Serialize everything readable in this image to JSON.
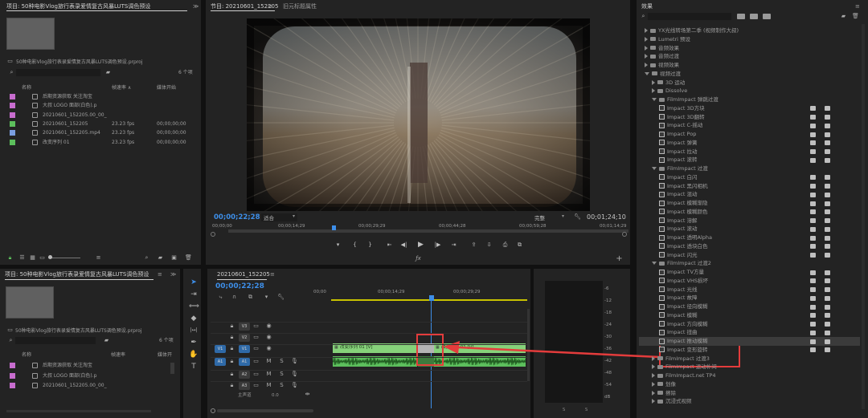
{
  "project_top": {
    "tab": "项目: 50种电影Vlog旅行表录爱情复古风暴LUTS调色预设",
    "tab2_arrow": "≫",
    "project_file": "50种电影Vlog旅行表录爱情复古风暴LUTS调色预设.prproj",
    "item_count": "6 个项",
    "col_name": "名称",
    "col_fps": "帧速率 ∧",
    "col_start": "媒体开始",
    "items": [
      {
        "color": "#c86dcf",
        "name": "后期资源获取 关注淘宝",
        "fps": "",
        "start": ""
      },
      {
        "color": "#c86dcf",
        "name": "大叔 LOGO 面部(白色).p",
        "fps": "",
        "start": ""
      },
      {
        "color": "#c86dcf",
        "name": "20210601_152205.00_00_55",
        "fps": "",
        "start": ""
      },
      {
        "color": "#5cbf5c",
        "name": "20210601_152205",
        "fps": "23.23 fps",
        "start": "00;00;00;00"
      },
      {
        "color": "#7a9ee0",
        "name": "20210601_152205.mp4",
        "fps": "23.23 fps",
        "start": "00;00;00;00"
      },
      {
        "color": "#5cbf5c",
        "name": "改变序列 01",
        "fps": "23.23 fps",
        "start": "00;00;00;00"
      }
    ]
  },
  "program": {
    "tab": "节目: 20210601_152205",
    "tab_menu": "≡",
    "tab2": "旧元标题属性",
    "timecode": "00;00;22;28",
    "fit": "适合",
    "quality": "完整",
    "duration": "00;01;24;10",
    "ruler": [
      "00;00;00",
      "00;00;14;29",
      "00;00;29;29",
      "00;00;44;28",
      "00;00;59;28",
      "00;01;14;29"
    ]
  },
  "effects": {
    "tab": "效果",
    "tab_menu": "≡",
    "tree": [
      {
        "level": 0,
        "kind": "folder",
        "open": false,
        "label": "YX光线转场第二季 (视频制作大叔)"
      },
      {
        "level": 0,
        "kind": "folder",
        "open": false,
        "label": "Lumetri 预设"
      },
      {
        "level": 0,
        "kind": "folder",
        "open": false,
        "label": "音频效果"
      },
      {
        "level": 0,
        "kind": "folder",
        "open": false,
        "label": "音频过渡"
      },
      {
        "level": 0,
        "kind": "folder",
        "open": false,
        "label": "视频效果"
      },
      {
        "level": 0,
        "kind": "folder",
        "open": true,
        "label": "视频过渡"
      },
      {
        "level": 1,
        "kind": "folder",
        "open": false,
        "label": "3D 运动"
      },
      {
        "level": 1,
        "kind": "folder",
        "open": false,
        "label": "Dissolve"
      },
      {
        "level": 1,
        "kind": "folder",
        "open": true,
        "label": "FilmImpact 弹跳过渡"
      },
      {
        "level": 2,
        "kind": "fx",
        "label": "Impact 3D方块",
        "badges": true
      },
      {
        "level": 2,
        "kind": "fx",
        "label": "Impact 3D翻转",
        "badges": true
      },
      {
        "level": 2,
        "kind": "fx",
        "label": "Impact C-摇动",
        "badges": true
      },
      {
        "level": 2,
        "kind": "fx",
        "label": "Impact Pop",
        "badges": true
      },
      {
        "level": 2,
        "kind": "fx",
        "label": "Impact 弹簧",
        "badges": true
      },
      {
        "level": 2,
        "kind": "fx",
        "label": "Impact 拉动",
        "badges": true
      },
      {
        "level": 2,
        "kind": "fx",
        "label": "Impact 滚转",
        "badges": true
      },
      {
        "level": 1,
        "kind": "folder",
        "open": true,
        "label": "FilmImpact 过渡"
      },
      {
        "level": 2,
        "kind": "fx",
        "label": "Impact 白闪",
        "badges": true
      },
      {
        "level": 2,
        "kind": "fx",
        "label": "Impact 黑闪相机",
        "badges": true
      },
      {
        "level": 2,
        "kind": "fx",
        "label": "Impact 混动",
        "badges": true
      },
      {
        "level": 2,
        "kind": "fx",
        "label": "Impact 模糊渐隐",
        "badges": true
      },
      {
        "level": 2,
        "kind": "fx",
        "label": "Impact 模糊颜色",
        "badges": true
      },
      {
        "level": 2,
        "kind": "fx",
        "label": "Impact 溶解",
        "badges": true
      },
      {
        "level": 2,
        "kind": "fx",
        "label": "Impact 滚动",
        "badges": true
      },
      {
        "level": 2,
        "kind": "fx",
        "label": "Impact 透明Alpha",
        "badges": true
      },
      {
        "level": 2,
        "kind": "fx",
        "label": "Impact 透块白色",
        "badges": true
      },
      {
        "level": 2,
        "kind": "fx",
        "label": "Impact 闪光",
        "badges": true
      },
      {
        "level": 1,
        "kind": "folder",
        "open": true,
        "label": "FilmImpact 过渡2"
      },
      {
        "level": 2,
        "kind": "fx",
        "label": "Impact TV方量",
        "badges": true
      },
      {
        "level": 2,
        "kind": "fx",
        "label": "Impact VHS损坏",
        "badges": true
      },
      {
        "level": 2,
        "kind": "fx",
        "label": "Impact 光线",
        "badges": true
      },
      {
        "level": 2,
        "kind": "fx",
        "label": "Impact 故障",
        "badges": true
      },
      {
        "level": 2,
        "kind": "fx",
        "label": "Impact 径向模糊",
        "badges": true
      },
      {
        "level": 2,
        "kind": "fx",
        "label": "Impact 模糊",
        "badges": true
      },
      {
        "level": 2,
        "kind": "fx",
        "label": "Impact 方向模糊",
        "badges": true
      },
      {
        "level": 2,
        "kind": "fx",
        "label": "Impact 扭曲",
        "badges": true
      },
      {
        "level": 2,
        "kind": "fx",
        "label": "Impact 推动模糊",
        "badges": true,
        "selected": true
      },
      {
        "level": 2,
        "kind": "fx",
        "label": "Impact 变形旋转",
        "badges": true
      },
      {
        "level": 1,
        "kind": "folder",
        "open": false,
        "label": "FilmImpact 过渡3"
      },
      {
        "level": 1,
        "kind": "folder",
        "open": false,
        "label": "FilmImpact 运动补间"
      },
      {
        "level": 1,
        "kind": "folder",
        "open": false,
        "label": "FilmImpact.net TP4"
      },
      {
        "level": 1,
        "kind": "folder",
        "open": false,
        "label": "划像"
      },
      {
        "level": 1,
        "kind": "folder",
        "open": false,
        "label": "擦除"
      },
      {
        "level": 1,
        "kind": "folder",
        "open": false,
        "label": "沉浸式视频"
      }
    ]
  },
  "project_bottom": {
    "tab": "项目: 50种电影Vlog旅行表录爱情复古风暴LUTS调色预设",
    "tab_menu": "≡",
    "tab2_arrow": "≫",
    "project_file": "50种电影Vlog旅行表录爱情复古风暴LUTS调色预设.prproj",
    "item_count": "6 个项",
    "col_name": "名称",
    "col_fps": "帧速率",
    "col_start": "媒体开",
    "items": [
      {
        "color": "#c86dcf",
        "name": "后期资源获取 关注淘宝"
      },
      {
        "color": "#c86dcf",
        "name": "大叔 LOGO 面部(白色).p"
      },
      {
        "color": "#c86dcf",
        "name": "20210601_152205.00_00_55"
      }
    ]
  },
  "timeline": {
    "tab": "20210601_152205",
    "tab_menu": "≡",
    "timecode": "00;00;22;28",
    "ruler": [
      "00;00",
      "00;00;14;29",
      "00;00;29;29"
    ],
    "tracks": [
      "V3",
      "V2",
      "V1",
      "A1",
      "A2",
      "A3"
    ],
    "left_targets": [
      "V1",
      "A1"
    ],
    "clip_v1_a": "改变序列 01 [V]",
    "clip_v1_b": "改变序列 01 [V]",
    "master": "主声道",
    "master_val": "0.0"
  },
  "meter": {
    "labels": [
      "-6",
      "-12",
      "-18",
      "-24",
      "-30",
      "-36",
      "-42",
      "-48",
      "-54",
      "dB"
    ],
    "s": "S"
  }
}
